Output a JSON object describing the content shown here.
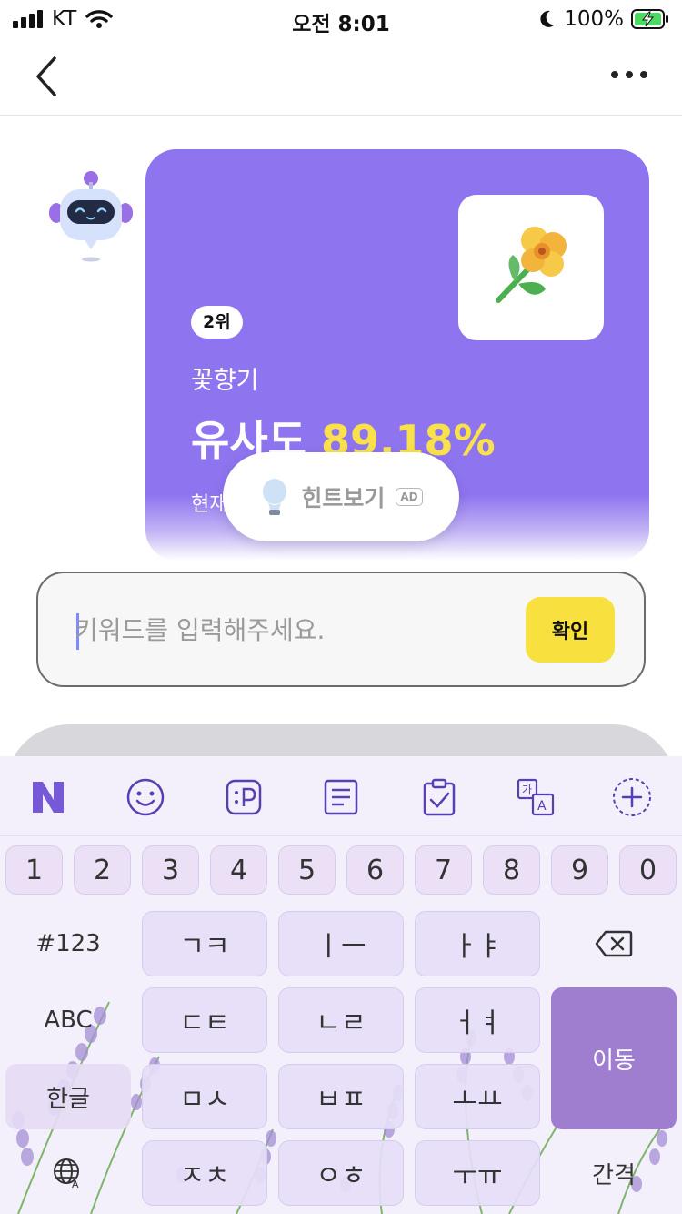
{
  "status_bar": {
    "carrier": "KT",
    "time": "오전 8:01",
    "battery": "100%"
  },
  "card": {
    "rank": "2위",
    "keyword": "꽃향기",
    "similarity_label": "유사도",
    "similarity_value": "89.18%",
    "current_label": "현재",
    "accent_color": "#8f74ef",
    "highlight_color": "#f8e14a"
  },
  "hint": {
    "label": "힌트보기",
    "ad": "AD"
  },
  "input": {
    "placeholder": "키워드를 입력해주세요.",
    "value": "",
    "confirm_label": "확인"
  },
  "keyboard": {
    "toolbar_icons": [
      "naver-icon",
      "emoji-icon",
      "sticker-icon",
      "memo-icon",
      "clipboard-icon",
      "translate-icon",
      "add-icon"
    ],
    "number_row": [
      "1",
      "2",
      "3",
      "4",
      "5",
      "6",
      "7",
      "8",
      "9",
      "0"
    ],
    "row1": {
      "left": "#123",
      "keys": [
        "ㄱㅋ",
        "ㅣㅡ",
        "ㅏㅑ"
      ]
    },
    "row2": {
      "left": "ABC",
      "keys": [
        "ㄷㅌ",
        "ㄴㄹ",
        "ㅓㅕ"
      ]
    },
    "row3": {
      "left": "한글",
      "keys": [
        "ㅁㅅ",
        "ㅂㅍ",
        "ㅗㅛ"
      ]
    },
    "row4": {
      "keys": [
        "ㅈㅊ",
        "ㅇㅎ",
        "ㅜㅠ"
      ]
    },
    "move_label": "이동",
    "space_label": "간격"
  }
}
